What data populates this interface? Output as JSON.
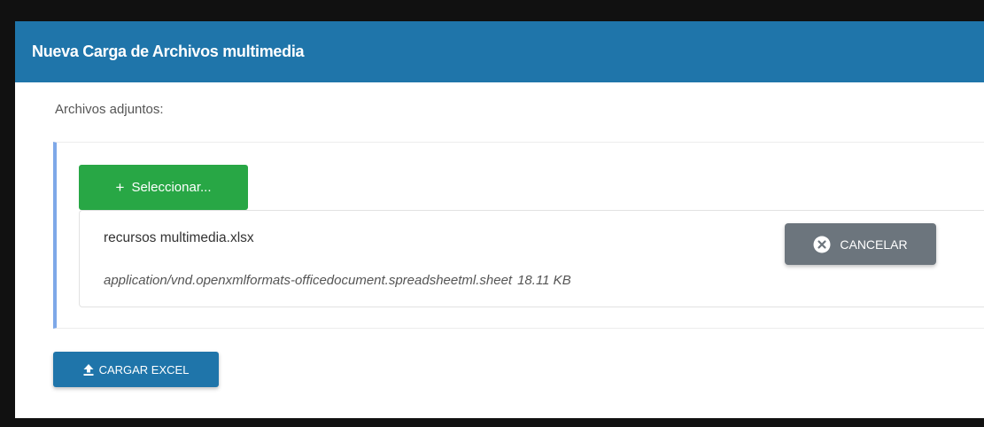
{
  "dialog": {
    "title": "Nueva Carga de Archivos multimedia"
  },
  "attachments": {
    "label": "Archivos adjuntos:",
    "select_button": {
      "icon": "plus-icon",
      "label": "Seleccionar..."
    },
    "file": {
      "name": "recursos multimedia.xlsx",
      "mime_type": "application/vnd.openxmlformats-officedocument.spreadsheetml.sheet",
      "size": "18.11 KB",
      "cancel_button": {
        "icon": "close-circle-icon",
        "label": "CANCELAR"
      }
    }
  },
  "actions": {
    "upload_button": {
      "icon": "upload-icon",
      "label": "CARGAR EXCEL"
    }
  },
  "colors": {
    "header": "#1f75aa",
    "select_button": "#28a745",
    "cancel_button": "#6c757d",
    "upload_button": "#1f75aa",
    "panel_accent": "#7ea8e8"
  }
}
